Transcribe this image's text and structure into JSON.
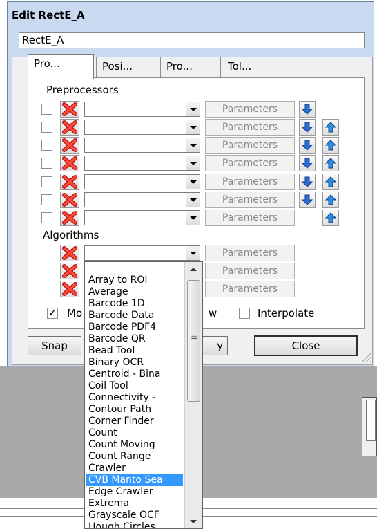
{
  "dialog": {
    "title": "Edit RectE_A",
    "name_value": "RectE_A",
    "tabs": [
      {
        "label": "Pro..."
      },
      {
        "label": "Posi..."
      },
      {
        "label": "Pro..."
      },
      {
        "label": "Tol..."
      }
    ],
    "preprocessors_label": "Preprocessors",
    "parameters_label": "Parameters",
    "algorithms_label": "Algorithms",
    "model_checkbox_label": "Mo",
    "partial_label": "w",
    "interpolate_label": "Interpolate",
    "snap_label": "Snap",
    "apply_partial_label": "y",
    "close_label": "Close"
  },
  "dropdown": {
    "items": [
      "Array to ROI",
      "Average",
      "Barcode 1D",
      "Barcode Data",
      "Barcode PDF4",
      "Barcode QR",
      "Bead Tool",
      "Binary OCR",
      "Centroid - Bina",
      "Coil Tool",
      "Connectivity -",
      "Contour Path",
      "Corner Finder",
      "Count",
      "Count Moving",
      "Count Range",
      "Crawler",
      "CVB Manto Sea",
      "Edge Crawler",
      "Extrema",
      "Grayscale OCF",
      "Hough Circles"
    ],
    "selected": "CVB Manto Sea"
  },
  "colors": {
    "accent_blue": "#3399ff",
    "delete_red": "#e02020",
    "arrow_blue": "#1e6fd8"
  }
}
